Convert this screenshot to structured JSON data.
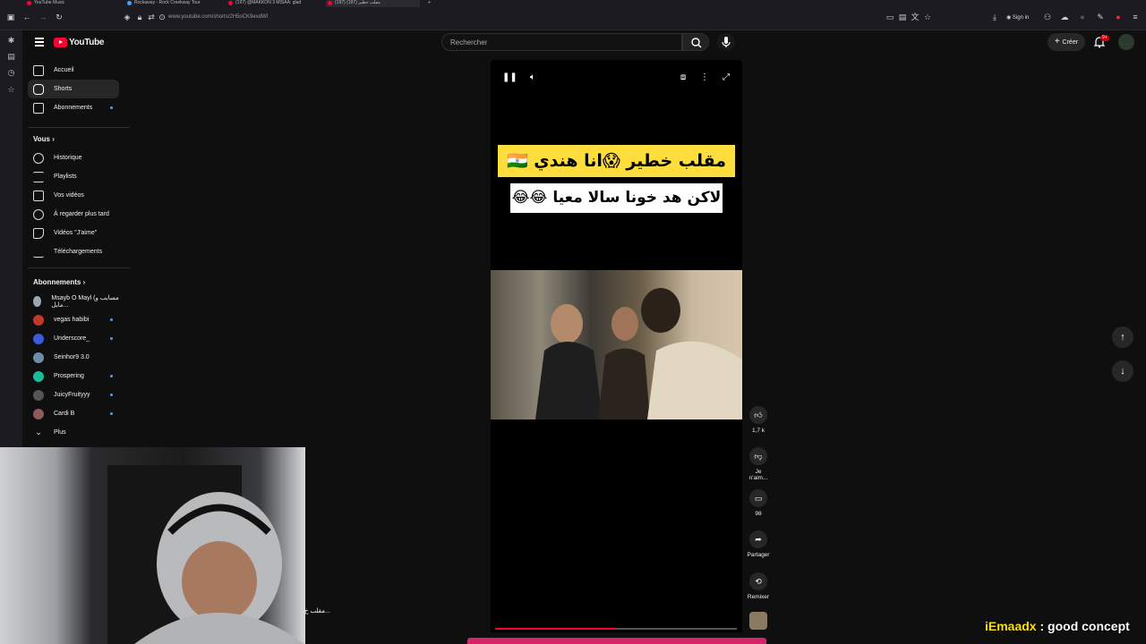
{
  "browser": {
    "tabs": [
      "YouTube Music",
      "Rockaway - Rock Creekway Tour",
      "(197) @MAKKON 3 MISAA: glad",
      "(197) مقلب خطير (197)"
    ],
    "url": "www.youtube.com/shorts/2H5oCK9exdWl",
    "sign_in": "Sign in"
  },
  "header": {
    "logo_text": "YouTube",
    "search_placeholder": "Rechercher",
    "create_label": "Créer",
    "notification_count": "9+"
  },
  "sidebar": {
    "main": [
      {
        "label": "Accueil",
        "icon": "home-icon"
      },
      {
        "label": "Shorts",
        "icon": "shorts-icon",
        "active": true
      },
      {
        "label": "Abonnements",
        "icon": "subscriptions-icon",
        "dot": true
      }
    ],
    "you_title": "Vous",
    "you_items": [
      {
        "label": "Historique",
        "icon": "history-icon"
      },
      {
        "label": "Playlists",
        "icon": "playlists-icon"
      },
      {
        "label": "Vos vidéos",
        "icon": "your-videos-icon"
      },
      {
        "label": "À regarder plus tard",
        "icon": "watch-later-icon"
      },
      {
        "label": "Vidéos \"J'aime\"",
        "icon": "liked-icon"
      },
      {
        "label": "Téléchargements",
        "icon": "downloads-icon"
      }
    ],
    "subs_title": "Abonnements",
    "subs": [
      {
        "label": "Msayb O Mayl (مسايب و مايل...",
        "color": "#9aa7b0",
        "dot": false
      },
      {
        "label": "vegas habibi",
        "color": "#c0392b",
        "dot": true
      },
      {
        "label": "Underscore_",
        "color": "#3b5bdb",
        "dot": true
      },
      {
        "label": "Seinhor9 3.0",
        "color": "#6b8fa8",
        "dot": false
      },
      {
        "label": "Prospering",
        "color": "#1abc9c",
        "dot": true
      },
      {
        "label": "JuicyFruityyy",
        "color": "#555555",
        "dot": true
      },
      {
        "label": "Cardi B",
        "color": "#8e5a5a",
        "dot": true
      }
    ],
    "more_label": "Plus"
  },
  "short": {
    "caption_line1": "مقلب خطير 😱انا هندي 🇮🇳",
    "caption_line2": "لاكن هد خونا سالا معيا 😂😂",
    "progress": 0.5
  },
  "actions": {
    "likes": "1,7 k",
    "dislike_label": "Je n'aim...",
    "comments": "98",
    "share_label": "Partager",
    "remix_label": "Remixer"
  },
  "overlay": {
    "stream_title": "...مقلب خ",
    "chat_user": "iEmaadx",
    "chat_message": " : good concept"
  },
  "colors": {
    "accent": "#ff0033",
    "caption_yellow": "#fedd3c",
    "chat_user": "#ffe100"
  }
}
